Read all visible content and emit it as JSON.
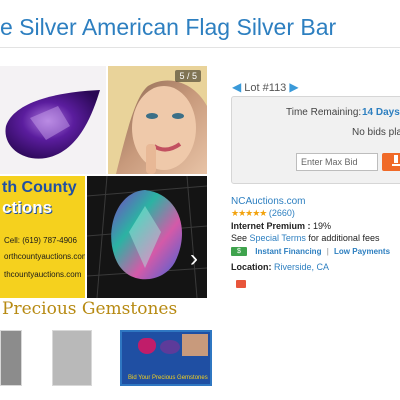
{
  "title": "e Silver American Flag Silver Bar",
  "gallery": {
    "counter": "5 / 5",
    "next_arrow": "›",
    "logo": {
      "line1": "th County",
      "line2": "ctions",
      "phone": "Cell: (619) 787-4906",
      "web1": "orthcountyauctions.com",
      "web2": "thcountyauctions.com"
    },
    "caption": "Precious Gemstones"
  },
  "thumbnail_caption": "Bid Your Precious Gemstones",
  "lot": {
    "prev": "◀",
    "label": "Lot #113",
    "next": "▶"
  },
  "bid_panel": {
    "time_label": "Time Remaining:",
    "time_value": "14 Days",
    "bids": "No bids pla",
    "input_placeholder": "Enter Max Bid"
  },
  "seller": {
    "name": "NCAuctions.com",
    "stars": "★★★★★",
    "rating_count": "(2660)",
    "premium_label": "Internet Premium :",
    "premium_value": "19%",
    "terms_prefix": "See",
    "terms_link": "Special Terms",
    "terms_suffix": "for additional fees",
    "financing_icon": "$",
    "financing": "Instant Financing",
    "payments": "Low Payments",
    "financing_sep": "|",
    "location_label": "Location:",
    "location_value": "Riverside, CA"
  },
  "colors": {
    "link": "#2d7fc0",
    "accent_button": "#f06a28",
    "stars": "#f2a20c",
    "logo_blue": "#1f4fa3",
    "logo_yellow": "#f5d11e"
  }
}
